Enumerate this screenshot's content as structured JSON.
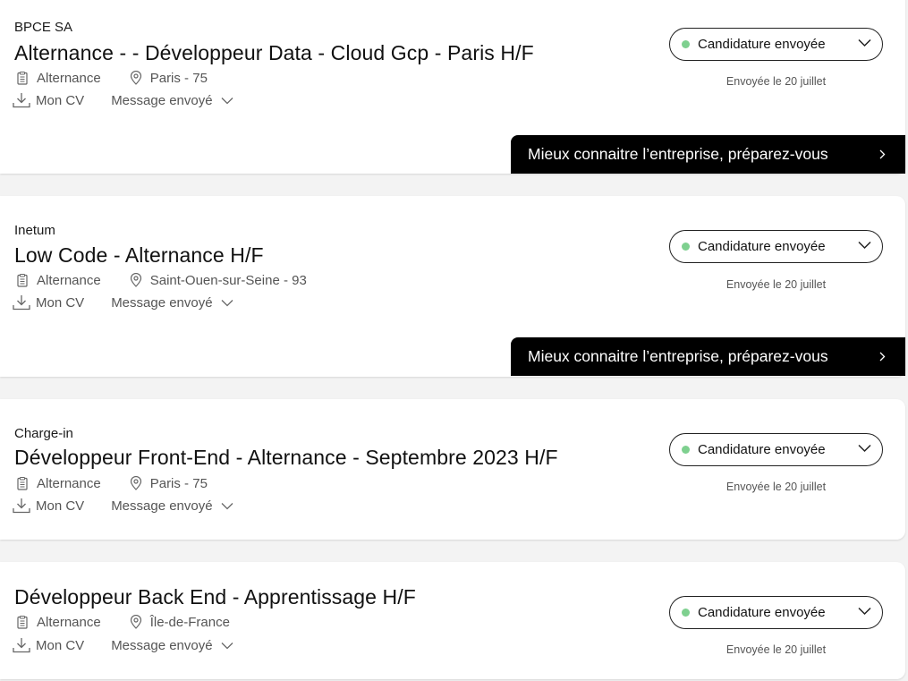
{
  "labels": {
    "cv": "Mon CV",
    "message": "Message envoyé",
    "status": "Candidature envoyée",
    "sent_date": "Envoyée le 20 juillet",
    "cta": "Mieux connaitre l’entreprise, préparez-vous"
  },
  "colors": {
    "status_dot": "#7ed08f",
    "cta_background": "#000000"
  },
  "applications": [
    {
      "company": "BPCE SA",
      "title": "Alternance - - Développeur Data - Cloud Gcp - Paris H/F",
      "contract": "Alternance",
      "location": "Paris - 75"
    },
    {
      "company": "Inetum",
      "title": "Low Code - Alternance H/F",
      "contract": "Alternance",
      "location": "Saint-Ouen-sur-Seine - 93"
    },
    {
      "company": "Charge-in",
      "title": "Développeur Front-End - Alternance - Septembre 2023 H/F",
      "contract": "Alternance",
      "location": "Paris - 75"
    },
    {
      "company": "",
      "title": "Développeur Back End - Apprentissage H/F",
      "contract": "Alternance",
      "location": "Île-de-France"
    }
  ]
}
